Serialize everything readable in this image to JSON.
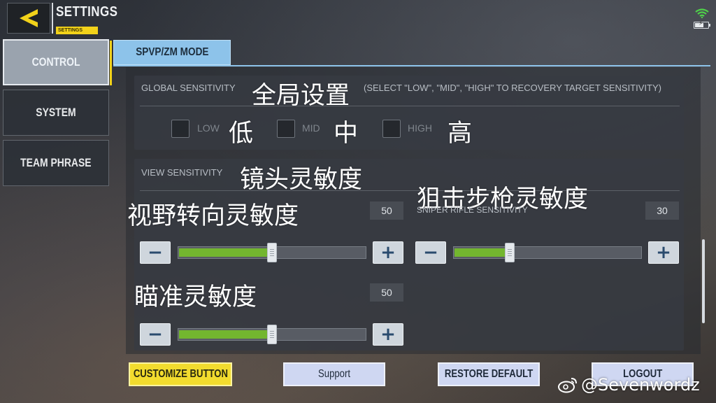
{
  "header": {
    "title": "SETTINGS",
    "subtitle": "SETTINGS",
    "back_icon": "back-arrow-icon",
    "accent_color": "#f2d21a"
  },
  "status_bar": {
    "icons": [
      "wifi-icon",
      "battery-charging-icon"
    ]
  },
  "sidebar": {
    "items": [
      {
        "label": "CONTROL",
        "active": true
      },
      {
        "label": "SYSTEM",
        "active": false
      },
      {
        "label": "TEAM PHRASE",
        "active": false
      }
    ]
  },
  "tabs": [
    {
      "label": "SPVP/ZM MODE",
      "active": true
    }
  ],
  "global_sensitivity": {
    "label": "GLOBAL SENSITIVITY",
    "hint": "(SELECT \"LOW\", \"MID\", \"HIGH\" TO RECOVERY TARGET SENSITIVITY)",
    "annotation": "全局设置",
    "options": [
      {
        "label": "LOW",
        "annotation": "低"
      },
      {
        "label": "MID",
        "annotation": "中"
      },
      {
        "label": "HIGH",
        "annotation": "高"
      }
    ]
  },
  "view_sensitivity": {
    "label": "VIEW SENSITIVITY",
    "annotation": "镜头灵敏度",
    "sliders": [
      {
        "label": "",
        "annotation": "视野转向灵敏度",
        "value": "50",
        "level": 0.5
      },
      {
        "label": "SNIPER RIFLE SENSITIVITY",
        "annotation": "狙击步枪灵敏度",
        "value": "30",
        "level": 0.3
      },
      {
        "label": "",
        "annotation": "瞄准灵敏度",
        "value": "50",
        "level": 0.5
      }
    ]
  },
  "stepper": {
    "minus": "−",
    "plus": "+"
  },
  "bottom_buttons": {
    "customize": "CUSTOMIZE BUTTON",
    "support": "Support",
    "restore": "RESTORE DEFAULT",
    "logout": "LOGOUT"
  },
  "watermark": "@Sevenwordz",
  "colors": {
    "slider_fill": "#73b62f",
    "tab_active": "#8dc3ea",
    "customize_button": "#f2dc2e",
    "light_button": "#cfd7f2"
  }
}
